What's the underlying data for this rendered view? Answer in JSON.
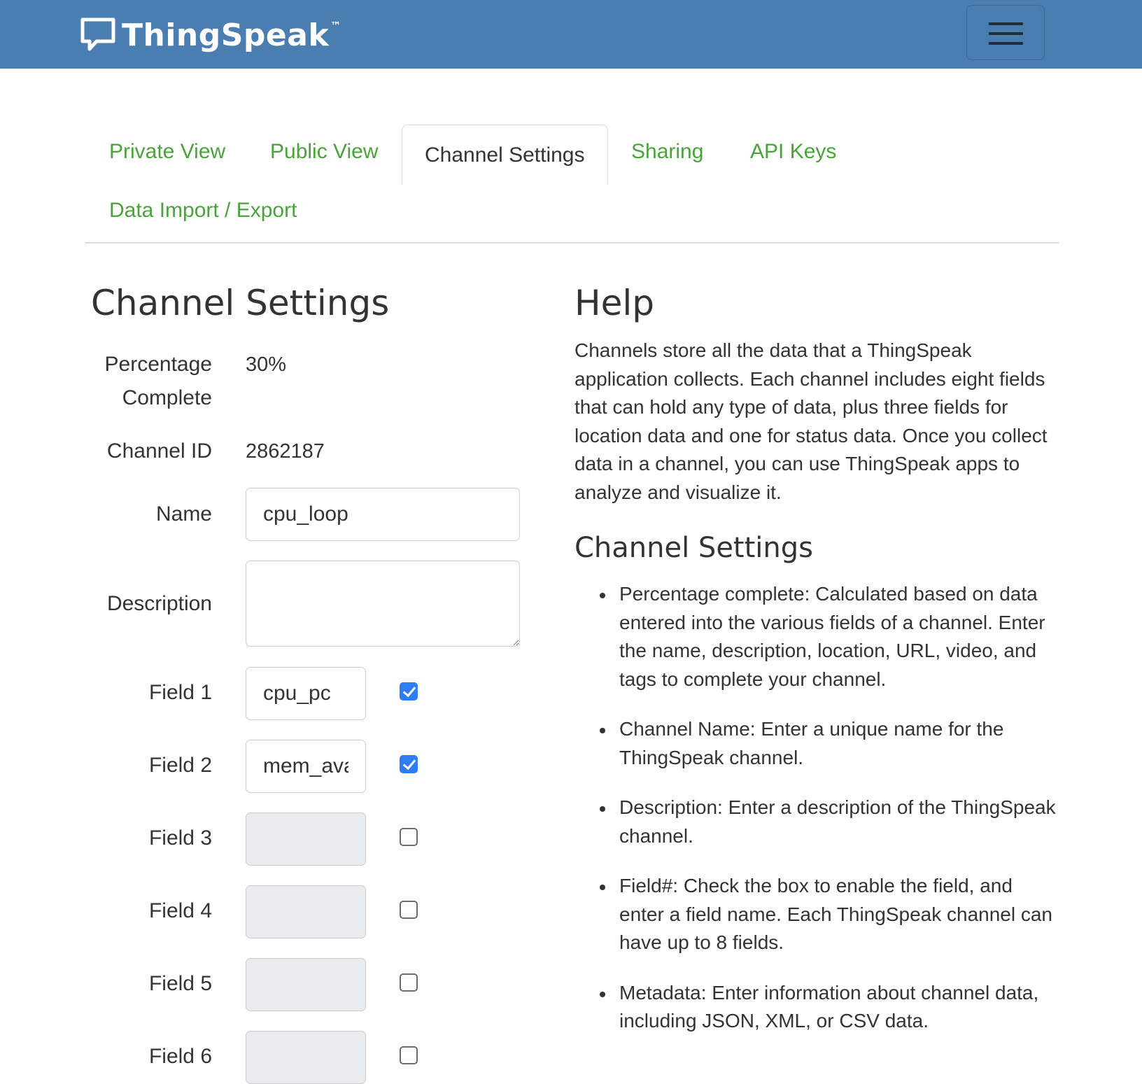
{
  "header": {
    "logo_text": "ThingSpeak",
    "logo_tm": "™",
    "menu_icon": "hamburger-menu-icon",
    "logo_icon": "speech-bubble-icon",
    "bg_color": "#4a7db0"
  },
  "tabs": [
    {
      "label": "Private View",
      "active": false
    },
    {
      "label": "Public View",
      "active": false
    },
    {
      "label": "Channel Settings",
      "active": true
    },
    {
      "label": "Sharing",
      "active": false
    },
    {
      "label": "API Keys",
      "active": false
    },
    {
      "label": "Data Import / Export",
      "active": false
    }
  ],
  "settings": {
    "title": "Channel Settings",
    "percentage_label_1": "Percentage",
    "percentage_label_2": "Complete",
    "percentage_value": "30%",
    "channel_id_label": "Channel ID",
    "channel_id_value": "2862187",
    "name_label": "Name",
    "name_value": "cpu_loop",
    "description_label": "Description",
    "description_value": "",
    "fields": [
      {
        "label": "Field 1",
        "value": "cpu_pc",
        "checked": true
      },
      {
        "label": "Field 2",
        "value": "mem_avail",
        "checked": true
      },
      {
        "label": "Field 3",
        "value": "",
        "checked": false
      },
      {
        "label": "Field 4",
        "value": "",
        "checked": false
      },
      {
        "label": "Field 5",
        "value": "",
        "checked": false
      },
      {
        "label": "Field 6",
        "value": "",
        "checked": false
      }
    ]
  },
  "help": {
    "title": "Help",
    "intro": "Channels store all the data that a ThingSpeak application collects. Each channel includes eight fields that can hold any type of data, plus three fields for location data and one for status data. Once you collect data in a channel, you can use ThingSpeak apps to analyze and visualize it.",
    "subtitle": "Channel Settings",
    "bullets": [
      "Percentage complete: Calculated based on data entered into the various fields of a channel. Enter the name, description, location, URL, video, and tags to complete your channel.",
      "Channel Name: Enter a unique name for the ThingSpeak channel.",
      "Description: Enter a description of the ThingSpeak channel.",
      "Field#: Check the box to enable the field, and enter a field name. Each ThingSpeak channel can have up to 8 fields.",
      "Metadata: Enter information about channel data, including JSON, XML, or CSV data."
    ]
  },
  "colors": {
    "tab_link": "#4aa33a",
    "checkbox_checked": "#2e7cf6",
    "disabled_input": "#e9ecef"
  }
}
